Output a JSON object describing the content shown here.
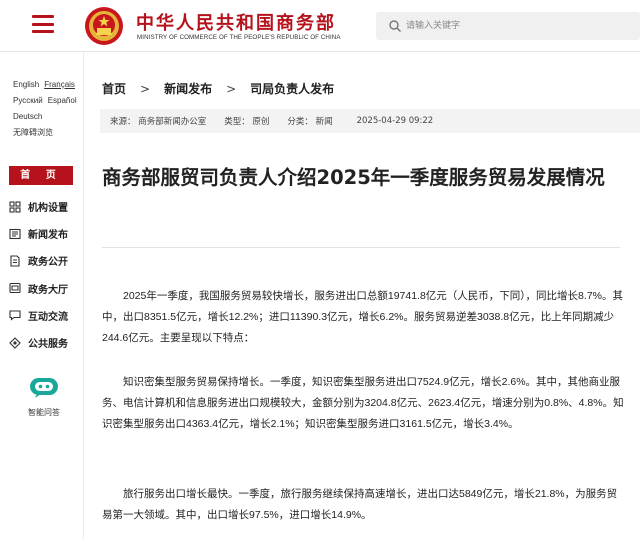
{
  "header": {
    "site_title": "中华人民共和国商务部",
    "site_subtitle": "MINISTRY OF COMMERCE OF THE PEOPLE'S REPUBLIC OF CHINA",
    "search_placeholder": "请输入关键字",
    "brand_color": "#b5121b"
  },
  "sidebar": {
    "languages": [
      [
        "English",
        "Français"
      ],
      [
        "Русский",
        "Español"
      ],
      [
        "Deutsch"
      ],
      [
        "无障碍浏览"
      ]
    ],
    "home_label": "首 页",
    "nav": [
      {
        "label": "机构设置",
        "icon": "grid-icon"
      },
      {
        "label": "新闻发布",
        "icon": "news-icon"
      },
      {
        "label": "政务公开",
        "icon": "document-icon"
      },
      {
        "label": "政务大厅",
        "icon": "hall-icon"
      },
      {
        "label": "互动交流",
        "icon": "chat-icon"
      },
      {
        "label": "公共服务",
        "icon": "service-icon"
      }
    ],
    "assistant_label": "智能问答"
  },
  "breadcrumb": [
    "首页",
    "新闻发布",
    "司局负责人发布"
  ],
  "meta": {
    "source": "来源：  商务部新闻办公室",
    "type": "类型：  原创",
    "category": "分类：  新闻",
    "date": "2025-04-29 09:22"
  },
  "article": {
    "title": "商务部服贸司负责人介绍2025年一季度服务贸易发展情况",
    "paragraphs": [
      "2025年一季度，我国服务贸易较快增长，服务进出口总额19741.8亿元（人民币，下同），同比增长8.7%。其中，出口8351.5亿元，增长12.2%；进口11390.3亿元，增长6.2%。服务贸易逆差3038.8亿元，比上年同期减少244.6亿元。主要呈现以下特点：",
      "知识密集型服务贸易保持增长。一季度，知识密集型服务进出口7524.9亿元，增长2.6%。其中，其他商业服务、电信计算机和信息服务进出口规模较大，金额分别为3204.8亿元、2623.4亿元，增速分别为0.8%、4.8%。知识密集型服务出口4363.4亿元，增长2.1%；知识密集型服务进口3161.5亿元，增长3.4%。",
      "旅行服务出口增长最快。一季度，旅行服务继续保持高速增长，进出口达5849亿元，增长21.8%，为服务贸易第一大领域。其中，出口增长97.5%，进口增长14.9%。"
    ]
  }
}
